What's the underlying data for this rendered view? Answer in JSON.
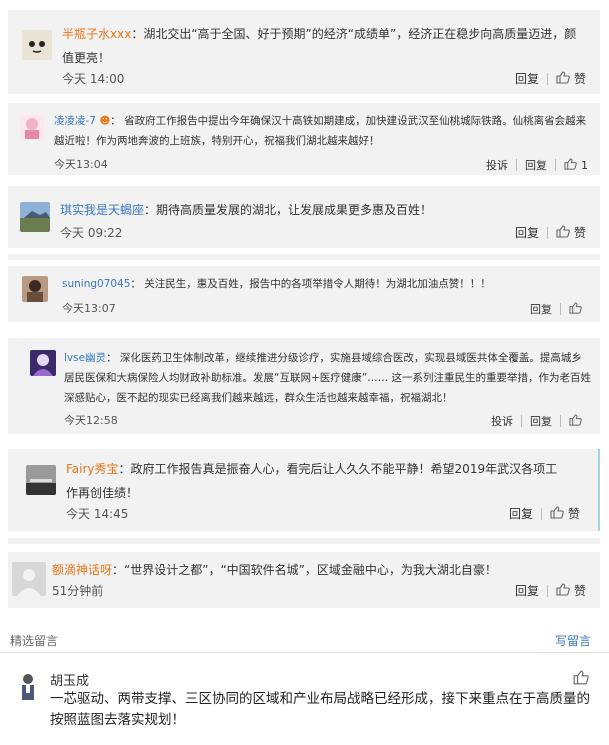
{
  "comments": [
    {
      "name": "半瓶子水xxx",
      "colon": "：",
      "text": "湖北交出“高于全国、好于预期”的经济“成绩单”，经济正在稳步向高质量迈进，颜值更亮！",
      "time": "今天 14:00",
      "reply": "回复",
      "like": "赞"
    },
    {
      "name": "凌凌凌-7",
      "colon": "：",
      "text": "省政府工作报告中提出今年确保汉十高铁如期建成，加快建设武汉至仙桃城际铁路。仙桃离省会越来越近啦！作为两地奔波的上班族，特别开心，祝福我们湖北越来越好！",
      "time": "今天13:04",
      "report": "投诉",
      "reply": "回复",
      "like": "1"
    },
    {
      "name": "琪实我是天蝎座",
      "colon": "：",
      "text": "期待高质量发展的湖北，让发展成果更多惠及百姓！",
      "time": "今天 09:22",
      "reply": "回复",
      "like": "赞"
    },
    {
      "name": "suning07045",
      "colon": "：",
      "text": "关注民生，惠及百姓，报告中的各项举措令人期待！为湖北加油点赞！！！",
      "time": "今天13:07",
      "reply": "回复",
      "like": ""
    },
    {
      "name": "lvse幽灵",
      "colon": "：",
      "text": "深化医药卫生体制改革，继续推进分级诊疗，实施县域综合医改，实现县域医共体全覆盖。提高城乡居民医保和大病保险人均财政补助标准。发展“互联网+医疗健康”…… 这一系列注重民生的重要举措，作为老百姓深感贴心，医不起的现实已经离我们越来越远，群众生活也越来越幸福，祝福湖北！",
      "time": "今天12:58",
      "report": "投诉",
      "reply": "回复",
      "like": ""
    },
    {
      "name": "Fairy秀宝",
      "colon": "：",
      "text": "政府工作报告真是振奋人心，看完后让人久久不能平静！希望2019年武汉各项工作再创佳绩！",
      "time": "今天 14:45",
      "reply": "回复",
      "like": "赞"
    },
    {
      "name": "额滴神话呀",
      "colon": "：",
      "text": "“世界设计之都”，“中国软件名城”，区域金融中心，为我大湖北自豪！",
      "time": "51分钟前",
      "reply": "回复",
      "like": "赞"
    }
  ],
  "featured": {
    "section_title": "精选留言",
    "write_label": "写留言",
    "name": "胡玉成",
    "text": "一芯驱动、两带支撑、三区协同的区域和产业布局战略已经形成，接下来重点在于高质量的按照蓝图去落实规划！"
  },
  "colors": {
    "name_orange": "#e8761a",
    "name_blue": "#3b78c4",
    "card_bg": "#f2f2f2"
  },
  "icons": [
    "avatar",
    "thumbs-up-icon"
  ]
}
